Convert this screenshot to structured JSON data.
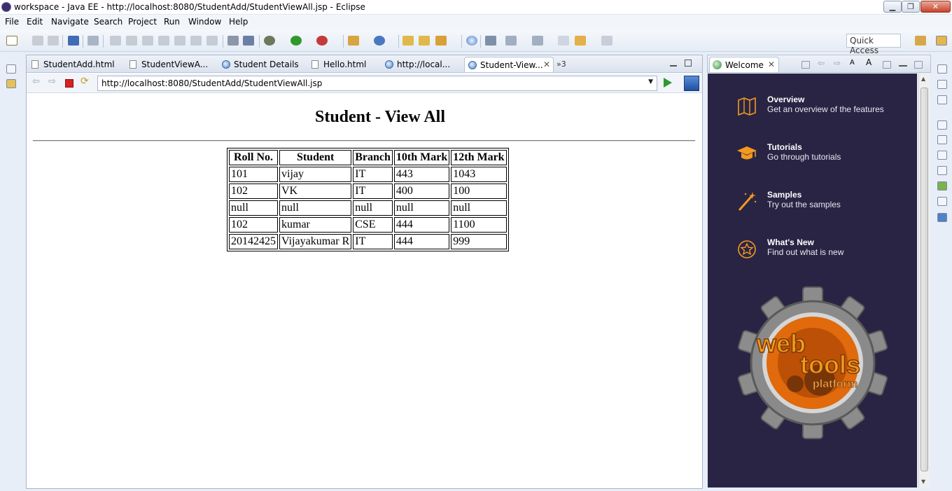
{
  "window": {
    "title": "workspace - Java EE - http://localhost:8080/StudentAdd/StudentViewAll.jsp - Eclipse"
  },
  "menu": [
    "File",
    "Edit",
    "Navigate",
    "Search",
    "Project",
    "Run",
    "Window",
    "Help"
  ],
  "toolbar": {
    "quick_access": "Quick Access"
  },
  "editor_tabs": [
    {
      "label": "StudentAdd.html",
      "icon": "document-icon"
    },
    {
      "label": "StudentViewA...",
      "icon": "document-icon"
    },
    {
      "label": "Student Details",
      "icon": "globe-icon"
    },
    {
      "label": "Hello.html",
      "icon": "document-icon"
    },
    {
      "label": "http://local...",
      "icon": "globe-icon"
    },
    {
      "label": "Student-View...",
      "icon": "globe-icon",
      "active": true
    }
  ],
  "tab_overflow": "»3",
  "browser": {
    "url": "http://localhost:8080/StudentAdd/StudentViewAll.jsp",
    "page_heading": "Student - View All",
    "table": {
      "headers": [
        "Roll No.",
        "Student",
        "Branch",
        "10th Mark",
        "12th Mark"
      ],
      "rows": [
        [
          "101",
          "vijay",
          "IT",
          "443",
          "1043"
        ],
        [
          "102",
          "VK",
          "IT",
          "400",
          "100"
        ],
        [
          "null",
          "null",
          "null",
          "null",
          "null"
        ],
        [
          "102",
          "kumar",
          "CSE",
          "444",
          "1100"
        ],
        [
          "20142425",
          "Vijayakumar R",
          "IT",
          "444",
          "999"
        ]
      ]
    }
  },
  "welcome": {
    "tab_label": "Welcome",
    "items": [
      {
        "title": "Overview",
        "desc": "Get an overview of the features",
        "icon": "map-icon"
      },
      {
        "title": "Tutorials",
        "desc": "Go through tutorials",
        "icon": "graduation-cap-icon"
      },
      {
        "title": "Samples",
        "desc": "Try out the samples",
        "icon": "magic-wand-icon"
      },
      {
        "title": "What's New",
        "desc": "Find out what is new",
        "icon": "star-icon"
      }
    ],
    "logo_text": [
      "web",
      "tools",
      "platform"
    ],
    "accent_color": "#f39a1f",
    "background_color": "#2a2444"
  }
}
